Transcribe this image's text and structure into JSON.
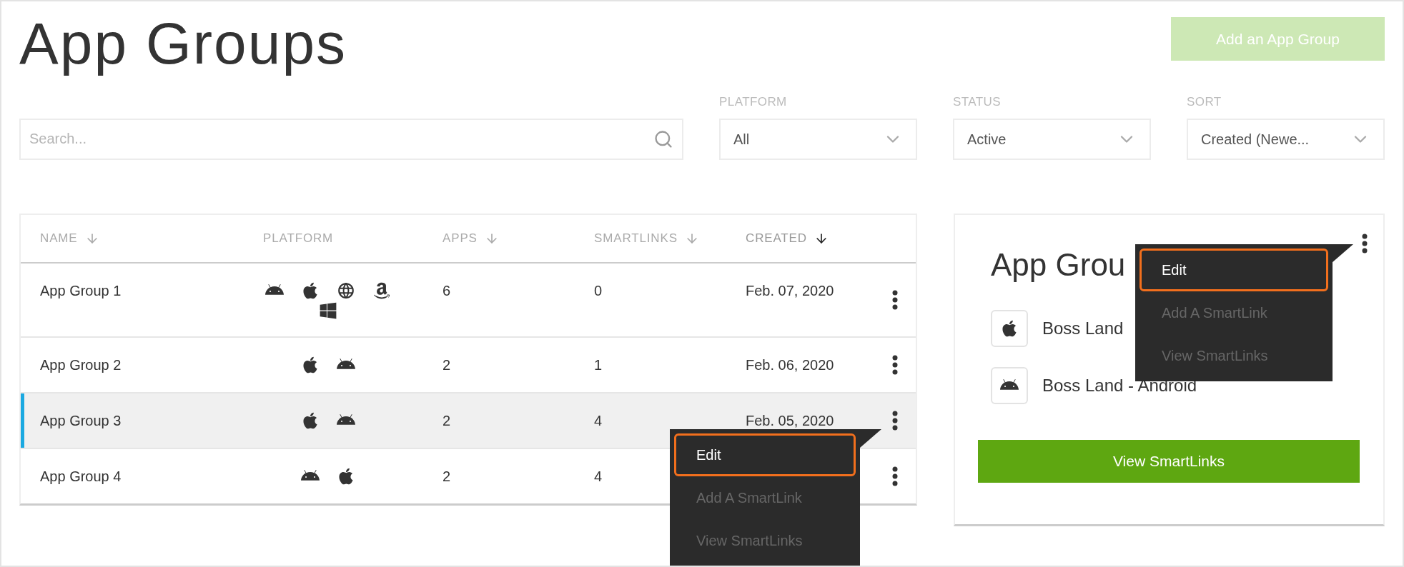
{
  "title": "App Groups",
  "add_button": "Add an App Group",
  "search": {
    "placeholder": "Search..."
  },
  "filters": [
    {
      "label": "PLATFORM",
      "value": "All"
    },
    {
      "label": "STATUS",
      "value": "Active"
    },
    {
      "label": "SORT",
      "value": "Created (Newe..."
    }
  ],
  "table": {
    "columns": [
      {
        "label": "NAME",
        "sortable": true,
        "selected": false
      },
      {
        "label": "PLATFORM",
        "sortable": false,
        "selected": false
      },
      {
        "label": "APPS",
        "sortable": true,
        "selected": false
      },
      {
        "label": "SMARTLINKS",
        "sortable": true,
        "selected": false
      },
      {
        "label": "CREATED",
        "sortable": true,
        "selected": true
      }
    ],
    "rows": [
      {
        "name": "App Group 1",
        "platforms": [
          {
            "kind": "android"
          },
          {
            "kind": "apple"
          },
          {
            "kind": "web"
          },
          {
            "kind": "amazon"
          },
          {
            "kind": "windows"
          }
        ],
        "apps": "6",
        "smartlinks": "0",
        "created": "Feb. 07, 2020",
        "selected": false,
        "menu_open": false
      },
      {
        "name": "App Group 2",
        "platforms": [
          {
            "kind": "apple"
          },
          {
            "kind": "android"
          }
        ],
        "apps": "2",
        "smartlinks": "1",
        "created": "Feb. 06, 2020",
        "selected": false,
        "menu_open": false
      },
      {
        "name": "App Group 3",
        "platforms": [
          {
            "kind": "apple"
          },
          {
            "kind": "android"
          }
        ],
        "apps": "2",
        "smartlinks": "4",
        "created": "Feb. 05, 2020",
        "selected": true,
        "menu_open": true
      },
      {
        "name": "App Group 4",
        "platforms": [
          {
            "kind": "android"
          },
          {
            "kind": "apple"
          }
        ],
        "apps": "2",
        "smartlinks": "4",
        "created": "",
        "selected": false,
        "menu_open": false
      }
    ]
  },
  "row_menu": [
    {
      "label": "Edit",
      "selected": true
    },
    {
      "label": "Add A SmartLink",
      "selected": false
    },
    {
      "label": "View SmartLinks",
      "selected": false
    }
  ],
  "detail": {
    "title": "App Grou",
    "apps": [
      {
        "kind": "apple",
        "name": "Boss Land"
      },
      {
        "kind": "android",
        "name": "Boss Land - Android"
      }
    ],
    "button": "View SmartLinks",
    "menu_open": true,
    "menu": [
      {
        "label": "Edit",
        "selected": true
      },
      {
        "label": "Add A SmartLink",
        "selected": false
      },
      {
        "label": "View SmartLinks",
        "selected": false
      }
    ]
  }
}
